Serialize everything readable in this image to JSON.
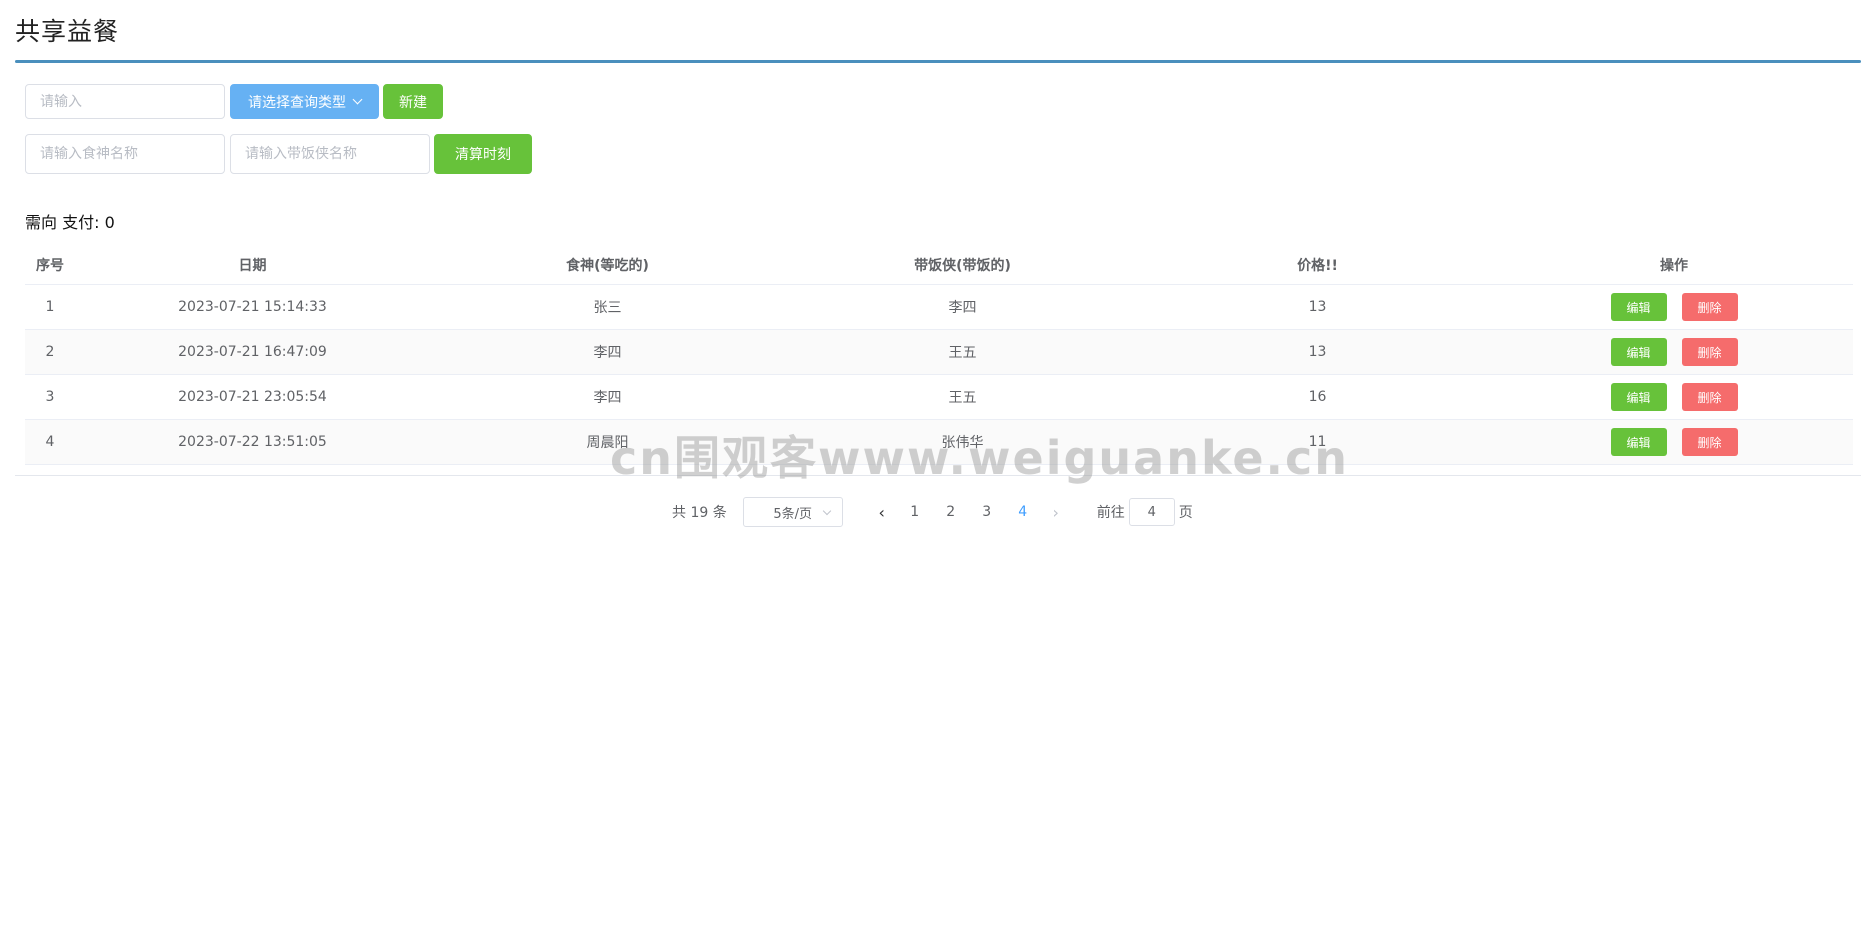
{
  "header": {
    "title": "共享益餐"
  },
  "toolbar": {
    "search_placeholder": "请输入",
    "type_select_label": "请选择查询类型",
    "new_label": "新建",
    "eater_placeholder": "请输入食神名称",
    "carrier_placeholder": "请输入带饭侠名称",
    "settle_label": "清算时刻"
  },
  "summary": {
    "pay_text": "需向 支付: 0"
  },
  "table": {
    "headers": [
      "序号",
      "日期",
      "食神(等吃的)",
      "带饭侠(带饭的)",
      "价格!!",
      "操作"
    ],
    "edit_label": "编辑",
    "delete_label": "删除",
    "rows": [
      {
        "id": "1",
        "date": "2023-07-21 15:14:33",
        "eater": "张三",
        "carrier": "李四",
        "price": "13"
      },
      {
        "id": "2",
        "date": "2023-07-21 16:47:09",
        "eater": "李四",
        "carrier": "王五",
        "price": "13"
      },
      {
        "id": "3",
        "date": "2023-07-21 23:05:54",
        "eater": "李四",
        "carrier": "王五",
        "price": "16"
      },
      {
        "id": "4",
        "date": "2023-07-22 13:51:05",
        "eater": "周晨阳",
        "carrier": "张伟华",
        "price": "11"
      }
    ]
  },
  "pagination": {
    "total_text": "共 19 条",
    "page_size": "5条/页",
    "pages": [
      "1",
      "2",
      "3",
      "4"
    ],
    "current_page": "4",
    "jump_prefix": "前往",
    "jump_value": "4",
    "jump_suffix": "页"
  },
  "watermark": {
    "text": "cn围观客www.weiguanke.cn"
  },
  "colors": {
    "accent_rule": "#4a8fbd",
    "primary_blue": "#66b1f3",
    "success_green": "#67c23a",
    "danger_red": "#f56c6c",
    "active_page": "#409eff"
  }
}
